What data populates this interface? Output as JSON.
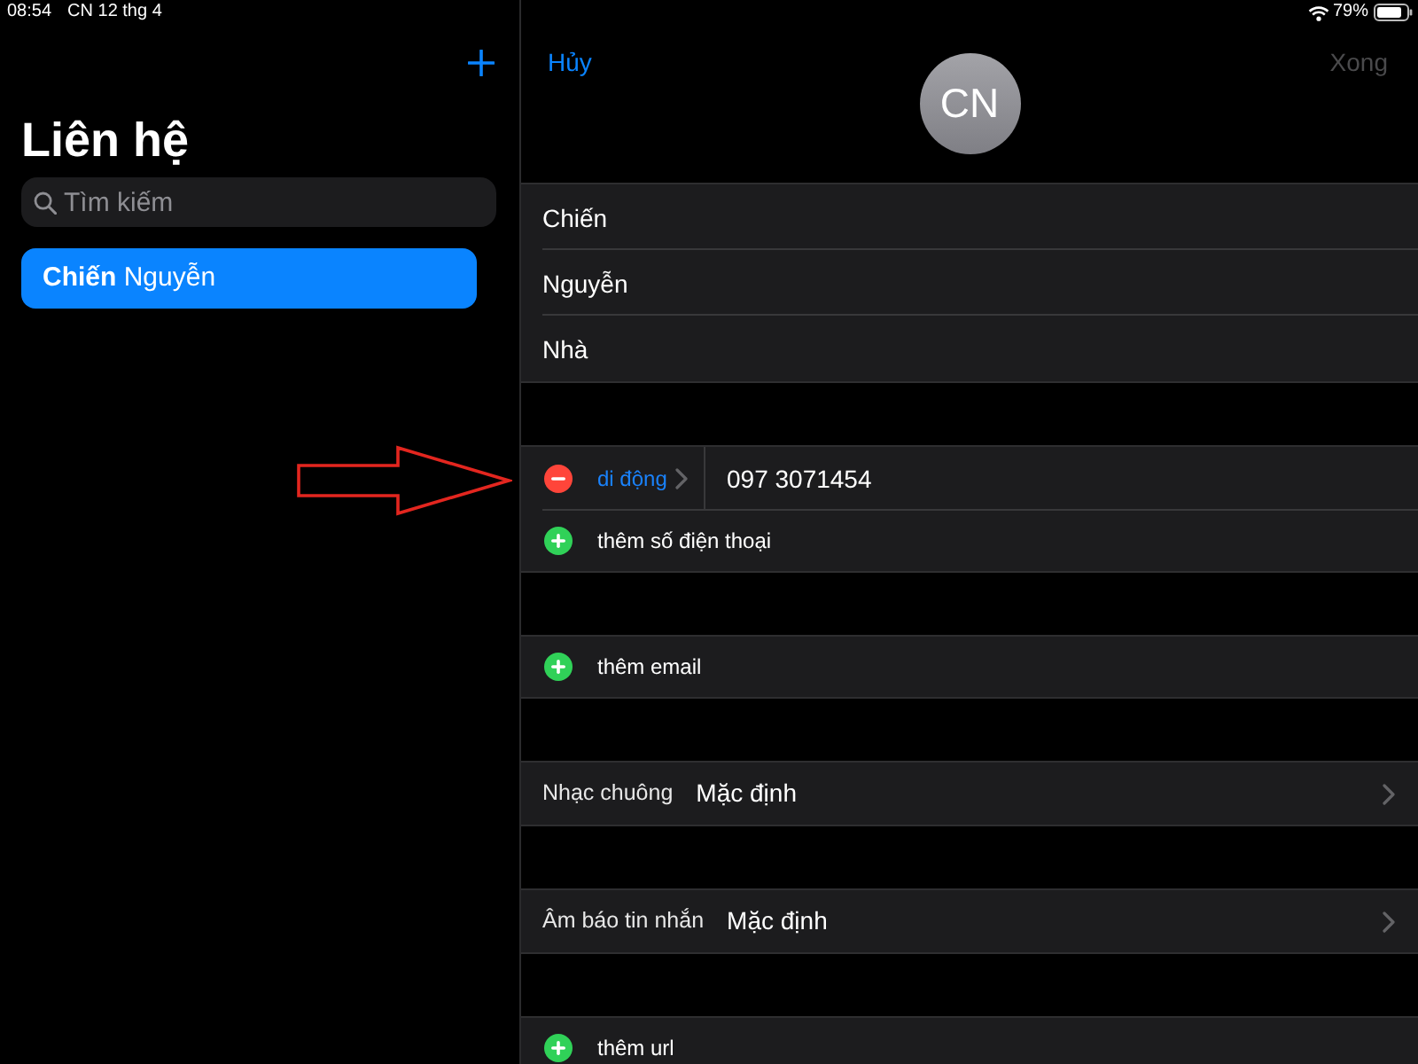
{
  "status_bar": {
    "time": "08:54",
    "date": "CN 12 thg 4",
    "battery": "79%"
  },
  "sidebar": {
    "title": "Liên hệ",
    "search": {
      "placeholder": "Tìm kiếm"
    },
    "contacts": [
      {
        "name": "**Chiến** Nguyễn",
        "selected": true
      }
    ]
  },
  "editor": {
    "cancel": "Hủy",
    "avatar_initials": "CN",
    "done": {
      "label": "Xong",
      "disabled": true
    },
    "name_fields": [
      {
        "value": "Chiến"
      },
      {
        "value": "Nguyễn"
      },
      {
        "value": "Nhà"
      }
    ],
    "sections": [
      {
        "rows": [
          {
            "kind": "phone",
            "label": "di động",
            "value": "097 3071454"
          },
          {
            "kind": "add",
            "label": "thêm số điện thoại"
          }
        ]
      },
      {
        "rows": [
          {
            "kind": "add",
            "label": "thêm email"
          }
        ]
      },
      {
        "rows": [
          {
            "kind": "setting",
            "label": "Nhạc chuông",
            "value": "Mặc định"
          }
        ]
      },
      {
        "rows": [
          {
            "kind": "setting",
            "label": "Âm báo tin nhắn",
            "value": "Mặc định"
          }
        ]
      },
      {
        "rows": [
          {
            "kind": "add",
            "label": "thêm url"
          }
        ]
      }
    ]
  }
}
